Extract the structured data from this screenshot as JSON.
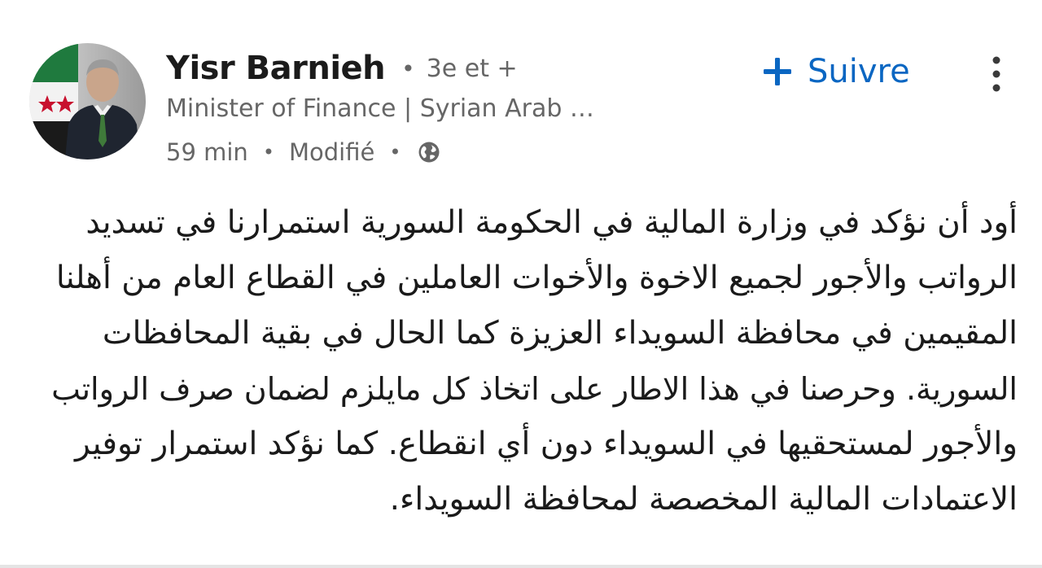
{
  "author": {
    "name": "Yisr Barnieh",
    "degree": "3e et +",
    "headline": "Minister of Finance | Syrian Arab …",
    "time": "59 min",
    "edited": "Modifié",
    "visibility_icon": "globe-icon",
    "avatar_icon": "profile-photo"
  },
  "actions": {
    "follow_label": "Suivre",
    "follow_icon": "plus-icon",
    "more_icon": "more-vertical-icon"
  },
  "post": {
    "lines": [
      "أود أن نؤكد في وزارة المالية في الحكومة السورية استمرارنا في تسديد",
      "الرواتب والأجور لجميع الاخوة والأخوات العاملين في القطاع العام من أهلنا",
      "المقيمين في محافظة السويداء العزيزة كما الحال في بقية المحافظات",
      "السورية. وحرصنا في هذا الاطار  على اتخاذ كل مايلزم لضمان صرف الرواتب",
      "والأجور لمستحقيها في السويداء دون أي انقطاع. كما نؤكد استمرار توفير",
      "الاعتمادات المالية المخصصة لمحافظة السويداء."
    ]
  },
  "colors": {
    "accent": "#0a66c2",
    "secondary_text": "#666666",
    "primary_text": "#1a1a1a"
  }
}
